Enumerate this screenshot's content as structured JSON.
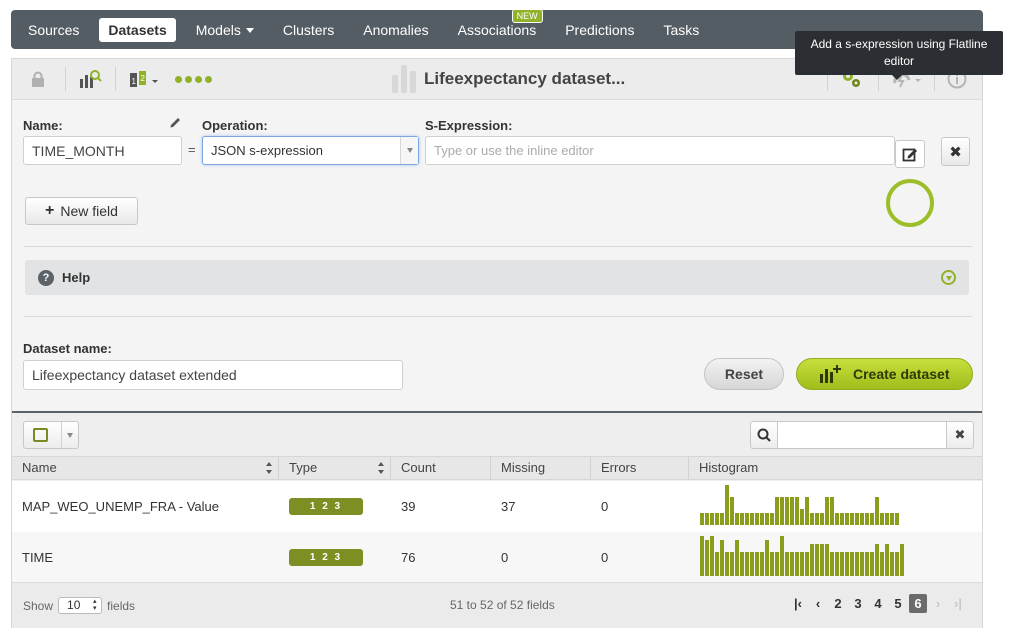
{
  "nav": {
    "items": [
      {
        "label": "Sources",
        "active": false
      },
      {
        "label": "Datasets",
        "active": true
      },
      {
        "label": "Models",
        "active": false,
        "dropdown": true
      },
      {
        "label": "Clusters",
        "active": false
      },
      {
        "label": "Anomalies",
        "active": false
      },
      {
        "label": "Associations",
        "active": false,
        "badge": "NEW"
      },
      {
        "label": "Predictions",
        "active": false
      },
      {
        "label": "Tasks",
        "active": false
      }
    ],
    "new_badge": "NEW"
  },
  "toolbar": {
    "dataset_title": "Lifeexpectancy dataset...",
    "icons": [
      "lock-icon",
      "dataset-stats-icon",
      "configure-dataset-icon",
      "progress-dots-icon",
      "settings-gears-icon",
      "actions-icon",
      "info-icon"
    ]
  },
  "form": {
    "name_label": "Name:",
    "name_value": "TIME_MONTH",
    "equals": "=",
    "operation_label": "Operation:",
    "operation_value": "JSON s-expression",
    "sexpr_label": "S-Expression:",
    "sexpr_placeholder": "Type or use the inline editor",
    "new_field_label": "New field",
    "help_label": "Help",
    "dataset_name_label": "Dataset name:",
    "dataset_name_value": "Lifeexpectancy dataset extended",
    "reset_label": "Reset",
    "create_label": "Create dataset"
  },
  "tooltip": {
    "text": "Add a s-expression using Flatline editor"
  },
  "table": {
    "columns": [
      "Name",
      "Type",
      "Count",
      "Missing",
      "Errors",
      "Histogram"
    ],
    "rows": [
      {
        "name": "MAP_WEO_UNEMP_FRA - Value",
        "type": "1 2 3",
        "count": "39",
        "missing": "37",
        "errors": "0",
        "histogram": [
          0.3,
          0.3,
          0.3,
          0.3,
          0.3,
          1.0,
          0.7,
          0.3,
          0.3,
          0.3,
          0.3,
          0.3,
          0.3,
          0.3,
          0.3,
          0.7,
          0.7,
          0.7,
          0.7,
          0.7,
          0.4,
          0.7,
          0.3,
          0.3,
          0.3,
          0.7,
          0.7,
          0.3,
          0.3,
          0.3,
          0.3,
          0.3,
          0.3,
          0.3,
          0.3,
          0.7,
          0.3,
          0.3,
          0.3,
          0.3
        ]
      },
      {
        "name": "TIME",
        "type": "1 2 3",
        "count": "76",
        "missing": "0",
        "errors": "0",
        "histogram": [
          1.0,
          0.9,
          1.0,
          0.6,
          0.9,
          0.6,
          0.6,
          0.9,
          0.6,
          0.6,
          0.6,
          0.6,
          0.6,
          0.9,
          0.6,
          0.6,
          1.0,
          0.6,
          0.6,
          0.6,
          0.6,
          0.6,
          0.8,
          0.8,
          0.8,
          0.8,
          0.6,
          0.6,
          0.6,
          0.6,
          0.6,
          0.6,
          0.6,
          0.6,
          0.6,
          0.8,
          0.6,
          0.8,
          0.6,
          0.6,
          0.8
        ]
      }
    ],
    "footer": {
      "show_label": "Show",
      "page_size": "10",
      "fields_label": "fields",
      "info": "51 to 52 of 52 fields",
      "pages": [
        "2",
        "3",
        "4",
        "5",
        "6"
      ],
      "current_page": "6"
    }
  },
  "colors": {
    "accent": "#8fb228",
    "nav_bg": "#555d64",
    "tooltip_bg": "#2b2f33"
  }
}
